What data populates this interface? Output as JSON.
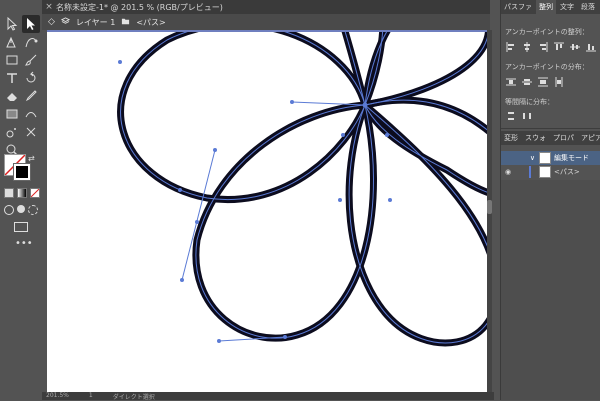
{
  "document": {
    "tab_title": "名称未設定-1* @ 201.5 % (RGB/プレビュー)",
    "close_glyph": "×"
  },
  "breadcrumb": {
    "layer_label": "レイヤー 1",
    "path_label": "<パス>"
  },
  "statusbar": {
    "zoom": "201.5%",
    "page": "1",
    "tool_hint": "ダイレクト選択"
  },
  "panel": {
    "tabs": [
      "パスファ",
      "整列",
      "文字",
      "段落"
    ],
    "active_tab": "整列",
    "align_anchor_title": "アンカーポイントの整列：",
    "distribute_anchor_title": "アンカーポイントの分布：",
    "equal_spacing_title": "等間隔に分布：",
    "layer_tabs": [
      "変形",
      "スウォ",
      "プロパ",
      "アピア"
    ],
    "layer_rows": [
      {
        "label": "編集モード",
        "expand_glyph": "∨"
      },
      {
        "label": "<パス>",
        "eye_glyph": "👁"
      }
    ]
  },
  "colors": {
    "accent": "#5b7bd5",
    "ui_bg": "#535353",
    "artboard": "#ffffff",
    "stroke": "#0c0c1e"
  },
  "icons": {
    "tools": [
      "selection-icon",
      "direct-selection-icon",
      "pen-icon",
      "curvature-icon",
      "rectangle-icon",
      "paintbrush-icon",
      "type-icon",
      "rotate-icon",
      "eraser-icon",
      "eyedropper-icon",
      "gradient-icon",
      "width-icon",
      "symbol-sprayer-icon",
      "shape-builder-icon",
      "artboard-icon",
      "blend-icon",
      "zoom-icon"
    ]
  }
}
